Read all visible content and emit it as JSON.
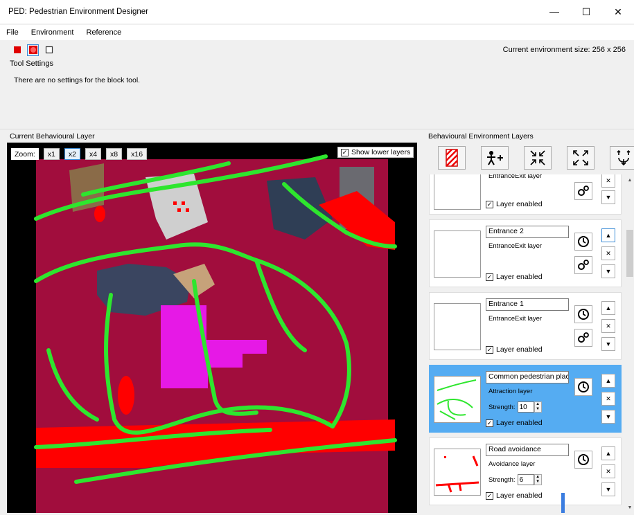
{
  "window": {
    "title": "PED: Pedestrian Environment Designer",
    "minimize": "—",
    "maximize": "☐",
    "close": "✕"
  },
  "menu": {
    "file": "File",
    "environment": "Environment",
    "reference": "Reference"
  },
  "toolbar": {
    "env_size": "Current environment size: 256 x 256"
  },
  "tool_settings": {
    "label": "Tool Settings",
    "text": "There are no settings for the block tool."
  },
  "left_panel": {
    "label": "Current Behavioural Layer",
    "zoom_label": "Zoom:",
    "zoom_levels": [
      "x1",
      "x2",
      "x4",
      "x8",
      "x16"
    ],
    "active_zoom": "x2",
    "show_lower_layers": "Show lower layers"
  },
  "right_panel": {
    "label": "Behavioural Environment Layers"
  },
  "layers": [
    {
      "name": "",
      "type": "EntranceExit layer",
      "enabled_label": "Layer enabled",
      "enabled": true,
      "strength": null,
      "has_clock": false,
      "has_gear": true
    },
    {
      "name": "Entrance 2",
      "type": "EntranceExit layer",
      "enabled_label": "Layer enabled",
      "enabled": true,
      "strength": null,
      "has_clock": true,
      "has_gear": true
    },
    {
      "name": "Entrance 1",
      "type": "EntranceExit layer",
      "enabled_label": "Layer enabled",
      "enabled": true,
      "strength": null,
      "has_clock": true,
      "has_gear": true
    },
    {
      "name": "Common pedestrian plac",
      "type": "Attraction layer",
      "enabled_label": "Layer enabled",
      "enabled": true,
      "strength_label": "Strength:",
      "strength": "10",
      "has_clock": true,
      "has_gear": false,
      "selected": true
    },
    {
      "name": "Road avoidance",
      "type": "Avoidance layer",
      "enabled_label": "Layer enabled",
      "enabled": true,
      "strength_label": "Strength:",
      "strength": "6",
      "has_clock": true,
      "has_gear": false
    }
  ],
  "colors": {
    "map_background": "#a10d3d",
    "attraction_path": "#2ee62e",
    "avoidance": "#ff0000",
    "entrance": "#ff00ff",
    "selected_layer": "#55acf2"
  }
}
